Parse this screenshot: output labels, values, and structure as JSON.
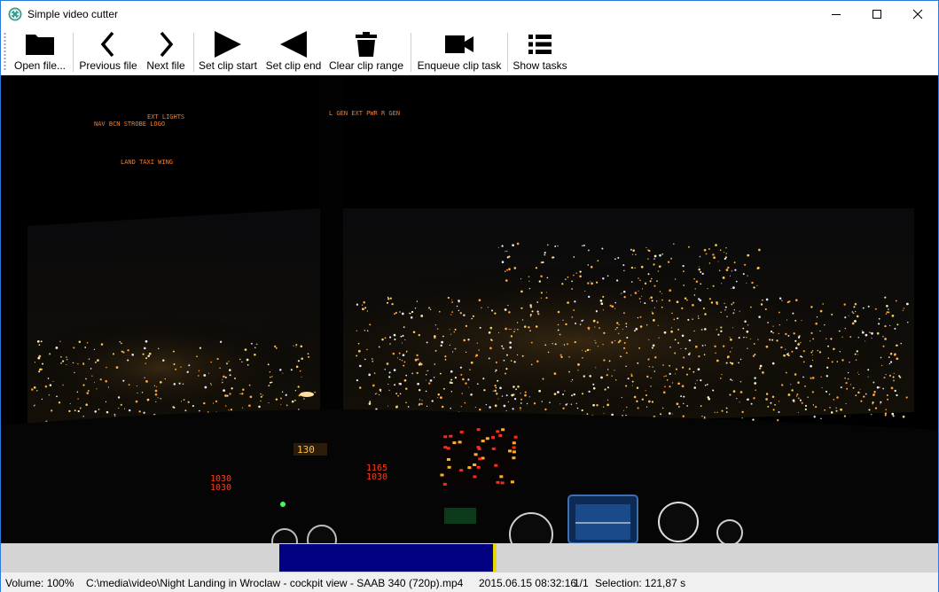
{
  "window": {
    "title": "Simple video cutter",
    "accent": "#2b79d8"
  },
  "toolbar": {
    "open_file": "Open file...",
    "previous_file": "Previous file",
    "next_file": "Next file",
    "set_clip_start": "Set clip start",
    "set_clip_end": "Set clip end",
    "clear_clip_range": "Clear clip range",
    "enqueue_clip_task": "Enqueue clip task",
    "show_tasks": "Show tasks"
  },
  "icons": {
    "open_file": "folder-icon",
    "previous_file": "chevron-left-icon",
    "next_file": "chevron-right-icon",
    "set_clip_start": "play-right-icon",
    "set_clip_end": "play-left-icon",
    "clear_clip_range": "trash-icon",
    "enqueue_clip_task": "video-camera-icon",
    "show_tasks": "list-icon"
  },
  "timeline": {
    "selection_color": "#000080",
    "playhead_color": "#e8d800",
    "background": "#d4d4d4"
  },
  "status": {
    "volume": "Volume: 100%",
    "file_path": "C:\\media\\video\\Night Landing in Wroclaw - cockpit view - SAAB 340 (720p).mp4",
    "position": "2015.06.15 08:32:16",
    "file_index": "1/1",
    "selection": "Selection: 121,87 s"
  },
  "video": {
    "overhead_panel_left": {
      "row1": "EXT LIGHTS",
      "row2": "NAV   BCN   STROBE   LOGO",
      "row3": "LAND   TAXI   WING"
    },
    "overhead_panel_right": "L GEN   EXT PWR   R GEN",
    "displays": [
      "1165",
      "1030",
      "1030",
      "1165",
      "130"
    ]
  }
}
